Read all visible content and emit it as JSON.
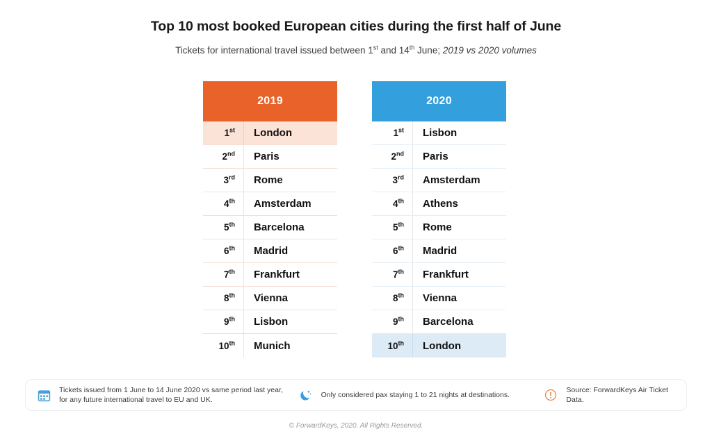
{
  "header": {
    "title": "Top 10 most booked European cities during the first half of June",
    "subtitle_part1": "Tickets for international travel issued between 1",
    "subtitle_sup1": "st",
    "subtitle_part2": " and 14",
    "subtitle_sup2": "th",
    "subtitle_part3": " June; ",
    "subtitle_italic": "2019 vs 2020 volumes"
  },
  "colors": {
    "orange": "#E8622A",
    "blue": "#339FDC",
    "orange_highlight": "#FCE3D7",
    "blue_highlight": "#DCEBF5"
  },
  "tables": [
    {
      "year": "2019",
      "rows": [
        {
          "rank": "1",
          "suffix": "st",
          "city": "London",
          "highlight": true
        },
        {
          "rank": "2",
          "suffix": "nd",
          "city": "Paris",
          "highlight": false
        },
        {
          "rank": "3",
          "suffix": "rd",
          "city": "Rome",
          "highlight": false
        },
        {
          "rank": "4",
          "suffix": "th",
          "city": "Amsterdam",
          "highlight": false
        },
        {
          "rank": "5",
          "suffix": "th",
          "city": "Barcelona",
          "highlight": false
        },
        {
          "rank": "6",
          "suffix": "th",
          "city": "Madrid",
          "highlight": false
        },
        {
          "rank": "7",
          "suffix": "th",
          "city": "Frankfurt",
          "highlight": false
        },
        {
          "rank": "8",
          "suffix": "th",
          "city": "Vienna",
          "highlight": false
        },
        {
          "rank": "9",
          "suffix": "th",
          "city": "Lisbon",
          "highlight": false
        },
        {
          "rank": "10",
          "suffix": "th",
          "city": "Munich",
          "highlight": false
        }
      ]
    },
    {
      "year": "2020",
      "rows": [
        {
          "rank": "1",
          "suffix": "st",
          "city": "Lisbon",
          "highlight": false
        },
        {
          "rank": "2",
          "suffix": "nd",
          "city": "Paris",
          "highlight": false
        },
        {
          "rank": "3",
          "suffix": "rd",
          "city": "Amsterdam",
          "highlight": false
        },
        {
          "rank": "4",
          "suffix": "th",
          "city": "Athens",
          "highlight": false
        },
        {
          "rank": "5",
          "suffix": "th",
          "city": "Rome",
          "highlight": false
        },
        {
          "rank": "6",
          "suffix": "th",
          "city": "Madrid",
          "highlight": false
        },
        {
          "rank": "7",
          "suffix": "th",
          "city": "Frankfurt",
          "highlight": false
        },
        {
          "rank": "8",
          "suffix": "th",
          "city": "Vienna",
          "highlight": false
        },
        {
          "rank": "9",
          "suffix": "th",
          "city": "Barcelona",
          "highlight": false
        },
        {
          "rank": "10",
          "suffix": "th",
          "city": "London",
          "highlight": true
        }
      ]
    }
  ],
  "footnotes": [
    {
      "icon": "calendar-icon",
      "text": "Tickets issued from 1 June to 14 June 2020 vs same period last year, for any future international travel to EU and UK."
    },
    {
      "icon": "moon-icon",
      "text": "Only considered pax staying 1 to 21 nights at destinations."
    },
    {
      "icon": "warning-icon",
      "text": "Source: ForwardKeys Air Ticket Data."
    }
  ],
  "copyright": "© ForwardKeys, 2020. All Rights Reserved."
}
